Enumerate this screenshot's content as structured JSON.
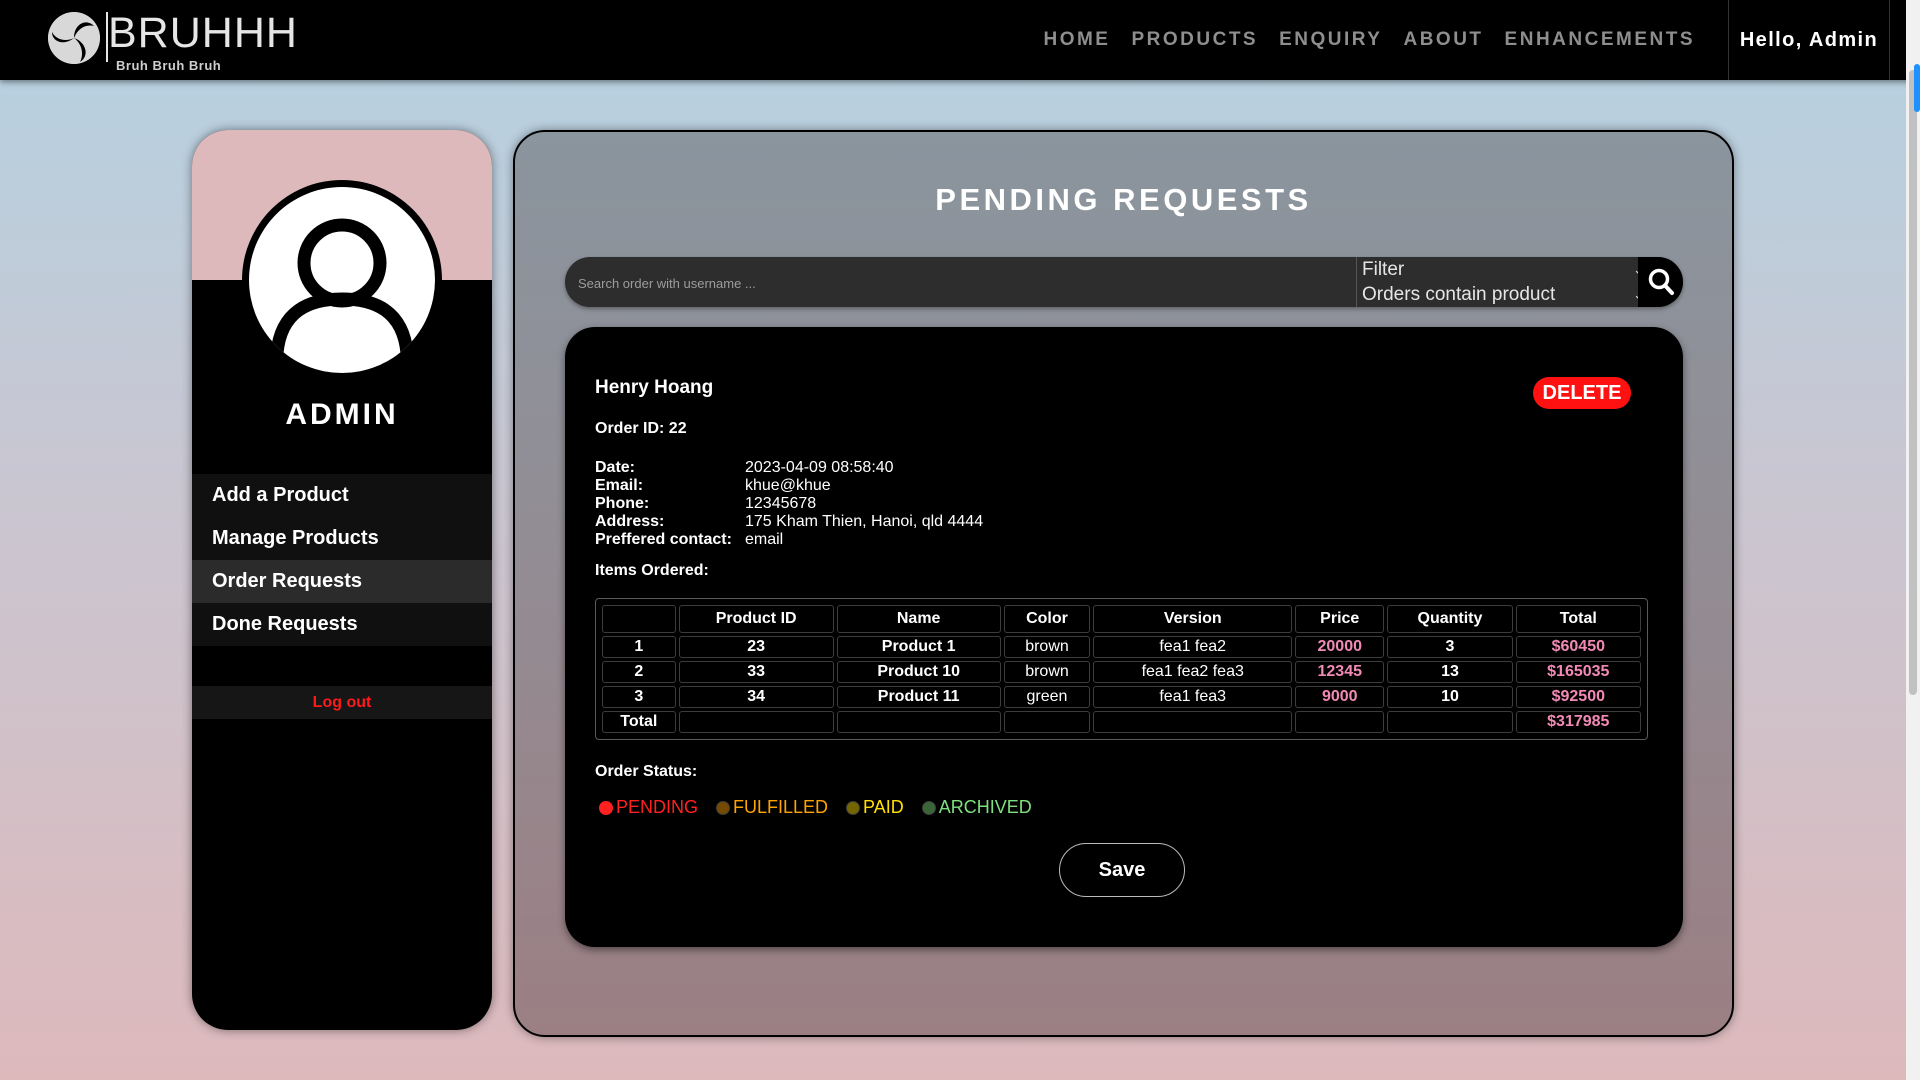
{
  "brand": {
    "title": "BRUHHH",
    "subtitle": "Bruh Bruh Bruh"
  },
  "nav": {
    "items": [
      "HOME",
      "PRODUCTS",
      "ENQUIRY",
      "ABOUT",
      "ENHANCEMENTS"
    ],
    "greeting": "Hello, Admin"
  },
  "sidebar": {
    "name": "ADMIN",
    "menu": [
      "Add a Product",
      "Manage Products",
      "Order Requests",
      "Done Requests"
    ],
    "active_index": 2,
    "logout": "Log out"
  },
  "page": {
    "title": "PENDING REQUESTS",
    "search_placeholder": "Search order with username ...",
    "filter_label": "Filter",
    "filter_value": "Orders contain product"
  },
  "order": {
    "customer": "Henry Hoang",
    "delete_label": "DELETE",
    "order_id_text": "Order ID: 22",
    "details": [
      {
        "label": "Date:",
        "value": "2023-04-09 08:58:40"
      },
      {
        "label": "Email:",
        "value": "khue@khue"
      },
      {
        "label": "Phone:",
        "value": "12345678"
      },
      {
        "label": "Address:",
        "value": "175 Kham Thien, Hanoi, qld 4444"
      },
      {
        "label": "Preffered contact:",
        "value": "email"
      }
    ],
    "items_label": "Items Ordered:",
    "table": {
      "headers": [
        "",
        "Product ID",
        "Name",
        "Color",
        "Version",
        "Price",
        "Quantity",
        "Total"
      ],
      "rows": [
        [
          "1",
          "23",
          "Product 1",
          "brown",
          "fea1 fea2",
          "20000",
          "3",
          "$60450"
        ],
        [
          "2",
          "33",
          "Product 10",
          "brown",
          "fea1 fea2 fea3",
          "12345",
          "13",
          "$165035"
        ],
        [
          "3",
          "34",
          "Product 11",
          "green",
          "fea1 fea3",
          "9000",
          "10",
          "$92500"
        ]
      ],
      "total_label": "Total",
      "grand_total": "$317985"
    },
    "status_label": "Order Status:",
    "statuses": [
      {
        "label": "PENDING",
        "color": "#ff2020",
        "selected": true
      },
      {
        "label": "FULFILLED",
        "color": "#ffa500",
        "selected": false
      },
      {
        "label": "PAID",
        "color": "#ffe000",
        "selected": false
      },
      {
        "label": "ARCHIVED",
        "color": "#7ee07e",
        "selected": false
      }
    ],
    "save_label": "Save"
  }
}
